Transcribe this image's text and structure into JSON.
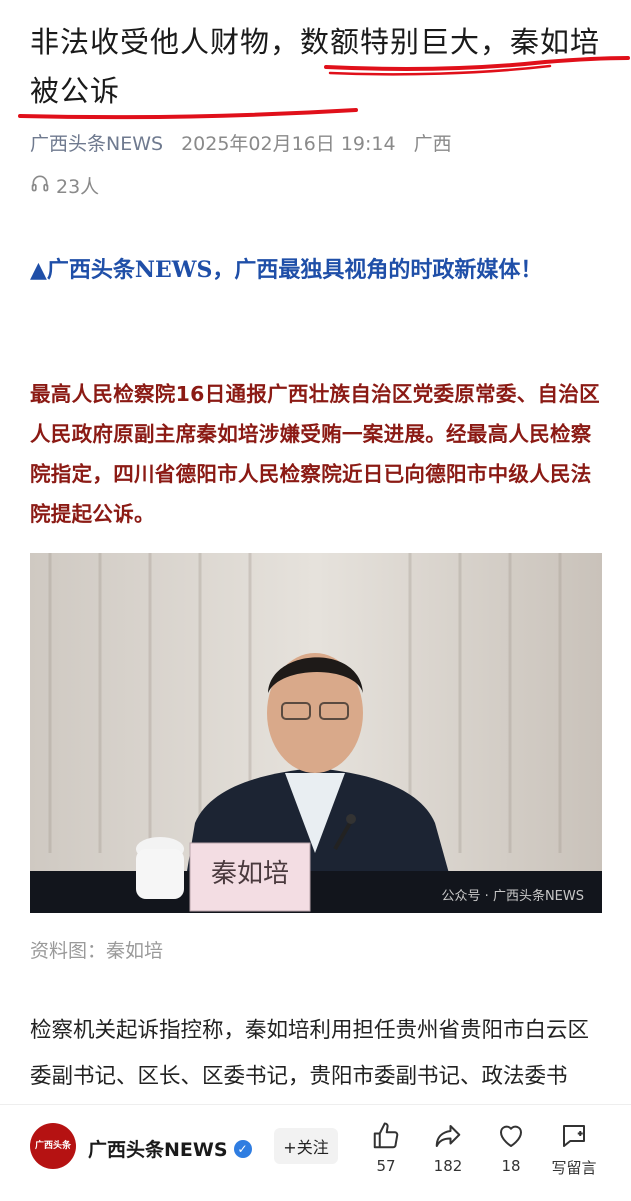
{
  "article": {
    "title": "非法收受他人财物，数额特别巨大，秦如培被公诉",
    "source": "广西头条NEWS",
    "datetime": "2025年02月16日 19:14",
    "region": "广西",
    "listen_count": "23人",
    "promo": "▲广西头条NEWS，广西最独具视角的时政新媒体！",
    "lead": "最高人民检察院16日通报广西壮族自治区党委原常委、自治区人民政府原副主席秦如培涉嫌受贿一案进展。经最高人民检察院指定，四川省德阳市人民检察院近日已向德阳市中级人民法院提起公诉。",
    "photo_nameplate": "秦如培",
    "photo_watermark": "公众号 · 广西头条NEWS",
    "caption": "资料图：秦如培",
    "body": "检察机关起诉指控称，秦如培利用担任贵州省贵阳市白云区委副书记、区长、区委书记，贵阳市委副书记、政法委书记、毕节地委副书记、行署专员"
  },
  "bottom_bar": {
    "account_name": "广西头条NEWS",
    "avatar_text": "广西头条",
    "follow_label": "+关注",
    "likes": "57",
    "shares": "182",
    "favorites": "18",
    "comment_label": "写留言"
  },
  "colors": {
    "promo_blue": "#1f4fa8",
    "lead_red": "#8b1a14",
    "scribble_red": "#e0101a",
    "verified_blue": "#2f7de1"
  }
}
